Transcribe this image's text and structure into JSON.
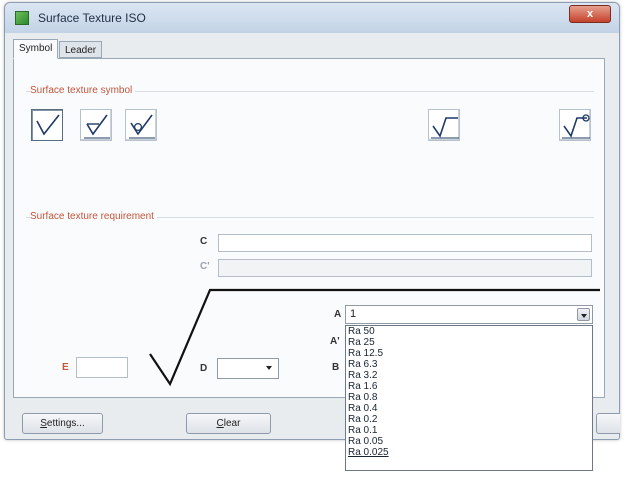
{
  "window": {
    "title": "Surface Texture ISO",
    "close_label": "x"
  },
  "tabs": [
    {
      "label": "Symbol",
      "active": true
    },
    {
      "label": "Leader",
      "active": false
    }
  ],
  "symbol_group": {
    "label": "Surface texture symbol",
    "buttons": [
      {
        "icon": "basic-texture-icon",
        "selected": true
      },
      {
        "icon": "machining-required-icon",
        "selected": false
      },
      {
        "icon": "machining-prohibited-icon",
        "selected": false
      },
      {
        "icon": "texture-with-line-icon",
        "selected": false
      },
      {
        "icon": "texture-all-around-icon",
        "selected": false
      }
    ]
  },
  "requirement_group": {
    "label": "Surface texture requirement",
    "labels": {
      "c": "C",
      "c_prime": "C'",
      "a": "A",
      "a_prime": "A'",
      "b": "B",
      "d": "D",
      "e": "E"
    },
    "fields": {
      "c_value": "",
      "c_prime_value": "",
      "e_value": ""
    },
    "a_combo_value": "1",
    "d_combo_value": "",
    "a_options": [
      "Ra 50",
      "Ra 25",
      "Ra 12.5",
      "Ra 6.3",
      "Ra 3.2",
      "Ra 1.6",
      "Ra 0.8",
      "Ra 0.4",
      "Ra 0.2",
      "Ra 0.1",
      "Ra 0.05",
      "Ra 0.025"
    ]
  },
  "buttons": {
    "settings_prefix": "S",
    "settings_rest": "ettings...",
    "clear_prefix": "C",
    "clear_rest": "lear"
  },
  "colors": {
    "group_label": "#c2563c",
    "close_button": "#c4422b"
  }
}
